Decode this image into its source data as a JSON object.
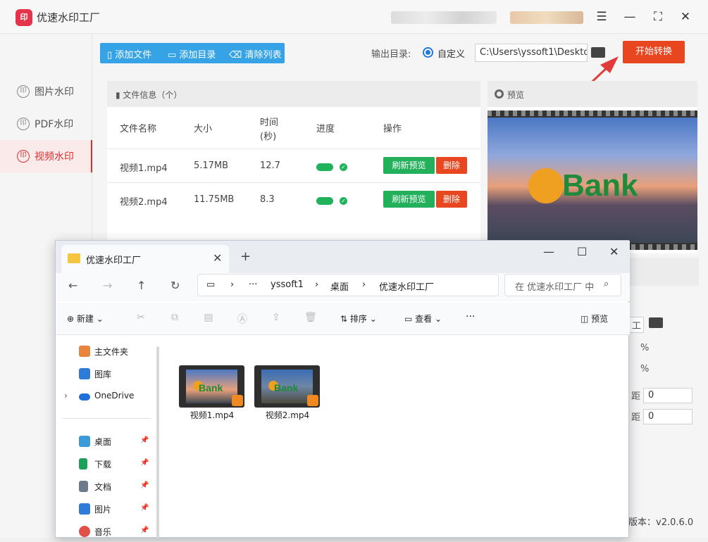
{
  "app": {
    "title": "优速水印工厂",
    "logo_text": "印",
    "version_text": "版本：v2.0.6.0",
    "colors": {
      "accent_red": "#e8461f",
      "toolbar_blue": "#35a3e6",
      "green": "#22b05a"
    }
  },
  "window_buttons": {
    "menu": "☰",
    "minimize": "—",
    "maximize": "⛶",
    "close": "✕"
  },
  "sidebar": {
    "items": [
      {
        "label": "图片水印",
        "icon": "印"
      },
      {
        "label": "PDF水印",
        "icon": "印"
      },
      {
        "label": "视频水印",
        "icon": "印",
        "active": true
      }
    ]
  },
  "toolbar": {
    "add_file": "添加文件",
    "add_dir": "添加目录",
    "clear_list": "清除列表"
  },
  "output": {
    "label": "输出目录:",
    "radio_label": "自定义",
    "path": "C:\\Users\\yssoft1\\Desktop"
  },
  "start_button": "开始转换",
  "file_panel": {
    "title": "文件信息（个）",
    "columns": {
      "name": "文件名称",
      "size": "大小",
      "time_line1": "时间",
      "time_line2": "(秒)",
      "progress": "进度",
      "action": "操作"
    },
    "rows": [
      {
        "name": "视频1.mp4",
        "size": "5.17MB",
        "time": "12.7",
        "progress": 1.0,
        "refresh": "刷新预览",
        "delete": "删除"
      },
      {
        "name": "视频2.mp4",
        "size": "11.75MB",
        "time": "8.3",
        "progress": 1.0,
        "refresh": "刷新预览",
        "delete": "删除"
      }
    ]
  },
  "preview": {
    "title": "预览",
    "watermark_text": "Bank"
  },
  "right_settings": {
    "frag1": "工",
    "pct1": "%",
    "pct2": "%",
    "label1": "距",
    "label2": "距",
    "val1": "0",
    "val2": "0"
  },
  "explorer": {
    "tab_title": "优速水印工厂",
    "breadcrumb": [
      "yssoft1",
      "桌面",
      "优速水印工厂"
    ],
    "search_placeholder": "在 优速水印工厂 中",
    "commands": {
      "new": "新建",
      "sort": "排序",
      "view": "查看",
      "more": "···",
      "preview": "预览"
    },
    "nav": [
      {
        "label": "主文件夹",
        "icon": "home-icon",
        "color": "#e8843c"
      },
      {
        "label": "图库",
        "icon": "gallery-icon",
        "color": "#2f7bd8"
      },
      {
        "label": "OneDrive",
        "icon": "cloud-icon",
        "color": "#1e6fd9"
      },
      {
        "label": "桌面",
        "icon": "desktop-icon",
        "color": "#3a9bd8"
      },
      {
        "label": "下载",
        "icon": "download-icon",
        "color": "#1ea05a"
      },
      {
        "label": "文档",
        "icon": "document-icon",
        "color": "#6c7b8c"
      },
      {
        "label": "图片",
        "icon": "picture-icon",
        "color": "#2f7bd8"
      },
      {
        "label": "音乐",
        "icon": "music-icon",
        "color": "#e2504a"
      }
    ],
    "files": [
      {
        "name": "视频1.mp4"
      },
      {
        "name": "视频2.mp4"
      }
    ]
  }
}
